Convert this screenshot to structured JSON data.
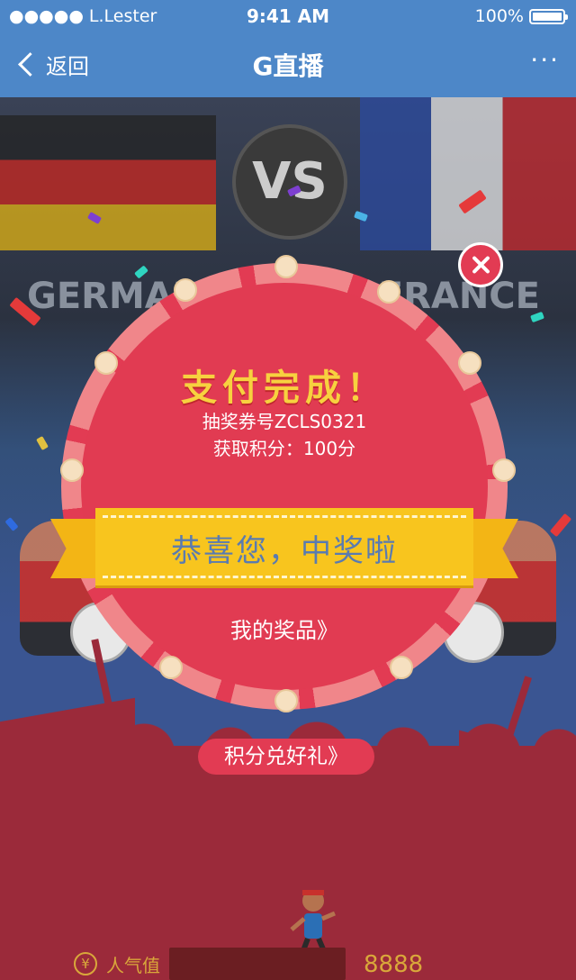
{
  "status_bar": {
    "carrier": "●●●●● L.Lester",
    "time": "9:41 AM",
    "battery": "100%"
  },
  "navbar": {
    "back_label": "返回",
    "title": "G直播",
    "more_label": "···"
  },
  "scene": {
    "team_left": "GERMANY",
    "team_right": "FRANCE",
    "vs_label": "VS"
  },
  "modal": {
    "title": "支付完成！",
    "ticket_line": "抽奖券号ZCLS0321",
    "points_line": "获取积分：100分",
    "ribbon_text": "恭喜您，中奖啦",
    "prize_link": "我的奖品》"
  },
  "redeem_button": "积分兑好礼》",
  "popularity": {
    "icon_symbol": "¥",
    "label": "人气值",
    "value": "8888"
  },
  "colors": {
    "nav_blue": "#4d87c8",
    "modal_red": "#e23b53",
    "ribbon_yellow": "#f8c51e",
    "gold": "#d9a73a"
  }
}
